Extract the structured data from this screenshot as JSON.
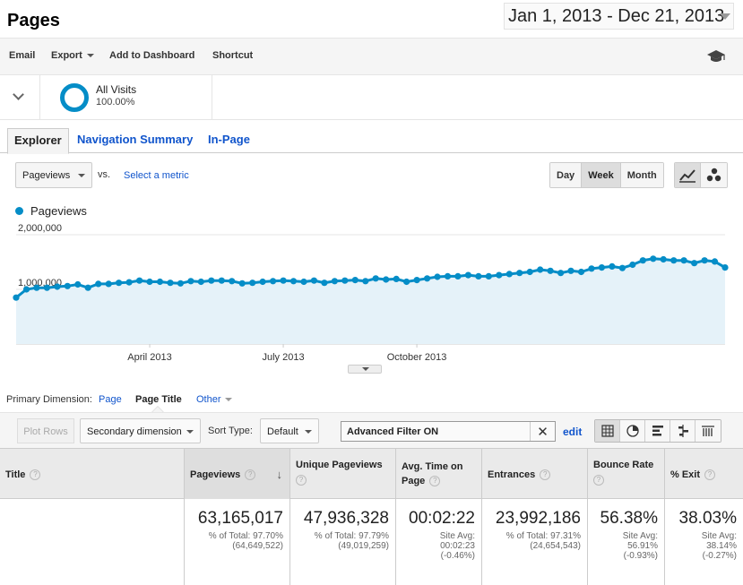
{
  "header": {
    "title": "Pages",
    "date_range": "Jan 1, 2013 - Dec 21, 2013"
  },
  "toolbar": {
    "email": "Email",
    "export": "Export",
    "add_to_dashboard": "Add to Dashboard",
    "shortcut": "Shortcut",
    "help_icon": "graduation-cap-icon"
  },
  "segment": {
    "name": "All Visits",
    "percent": "100.00%",
    "color": "#058dc7"
  },
  "tabs": [
    {
      "label": "Explorer",
      "active": true
    },
    {
      "label": "Navigation Summary",
      "active": false
    },
    {
      "label": "In-Page",
      "active": false
    }
  ],
  "chart_controls": {
    "metric": "Pageviews",
    "vs": "vs.",
    "select_metric": "Select a metric",
    "granularity": [
      {
        "label": "Day",
        "active": false
      },
      {
        "label": "Week",
        "active": true
      },
      {
        "label": "Month",
        "active": false
      }
    ]
  },
  "chart_data": {
    "type": "area",
    "series": [
      {
        "name": "Pageviews",
        "color": "#058dc7",
        "values": [
          850000,
          1000000,
          1030000,
          1030000,
          1050000,
          1060000,
          1090000,
          1030000,
          1100000,
          1100000,
          1120000,
          1130000,
          1160000,
          1140000,
          1140000,
          1120000,
          1110000,
          1150000,
          1140000,
          1160000,
          1160000,
          1150000,
          1110000,
          1120000,
          1140000,
          1150000,
          1160000,
          1150000,
          1140000,
          1160000,
          1120000,
          1150000,
          1160000,
          1170000,
          1150000,
          1200000,
          1180000,
          1190000,
          1140000,
          1170000,
          1200000,
          1230000,
          1240000,
          1240000,
          1260000,
          1240000,
          1240000,
          1260000,
          1280000,
          1300000,
          1320000,
          1360000,
          1340000,
          1300000,
          1340000,
          1320000,
          1380000,
          1400000,
          1420000,
          1390000,
          1450000,
          1530000,
          1560000,
          1550000,
          1530000,
          1530000,
          1480000,
          1530000,
          1510000,
          1400000
        ]
      }
    ],
    "y_ticks": [
      "2,000,000",
      "1,000,000"
    ],
    "y_tick_values": [
      2000000,
      1000000
    ],
    "x_ticks": [
      "April 2013",
      "July 2013",
      "October 2013"
    ],
    "x_tick_indices": [
      13,
      26,
      39
    ],
    "ylim": [
      0,
      2000000
    ],
    "grid": true,
    "legend": "top-left"
  },
  "primary_dimension": {
    "label": "Primary Dimension:",
    "options": [
      {
        "label": "Page",
        "active": false
      },
      {
        "label": "Page Title",
        "active": true
      },
      {
        "label": "Other",
        "active": false
      }
    ]
  },
  "table_controls": {
    "plot_rows": "Plot Rows",
    "secondary_dimension": "Secondary dimension",
    "sort_type_label": "Sort Type:",
    "sort_type_value": "Default",
    "filter_text": "Advanced Filter ON",
    "filter_clear": "✕",
    "edit": "edit"
  },
  "table": {
    "columns": [
      "Title",
      "Pageviews",
      "Unique Pageviews",
      "Avg. Time on Page",
      "Entrances",
      "Bounce Rate",
      "% Exit"
    ],
    "totals": [
      {
        "value": "63,165,017",
        "line1": "% of Total: 97.70%",
        "line2": "(64,649,522)"
      },
      {
        "value": "47,936,328",
        "line1": "% of Total: 97.79%",
        "line2": "(49,019,259)"
      },
      {
        "value": "00:02:22",
        "line1": "Site Avg:",
        "line2": "00:02:23",
        "line3": "(-0.46%)"
      },
      {
        "value": "23,992,186",
        "line1": "% of Total: 97.31%",
        "line2": "(24,654,543)"
      },
      {
        "value": "56.38%",
        "line1": "Site Avg:",
        "line2": "56.91%",
        "line3": "(-0.93%)"
      },
      {
        "value": "38.03%",
        "line1": "Site Avg:",
        "line2": "38.14%",
        "line3": "(-0.27%)"
      }
    ]
  }
}
